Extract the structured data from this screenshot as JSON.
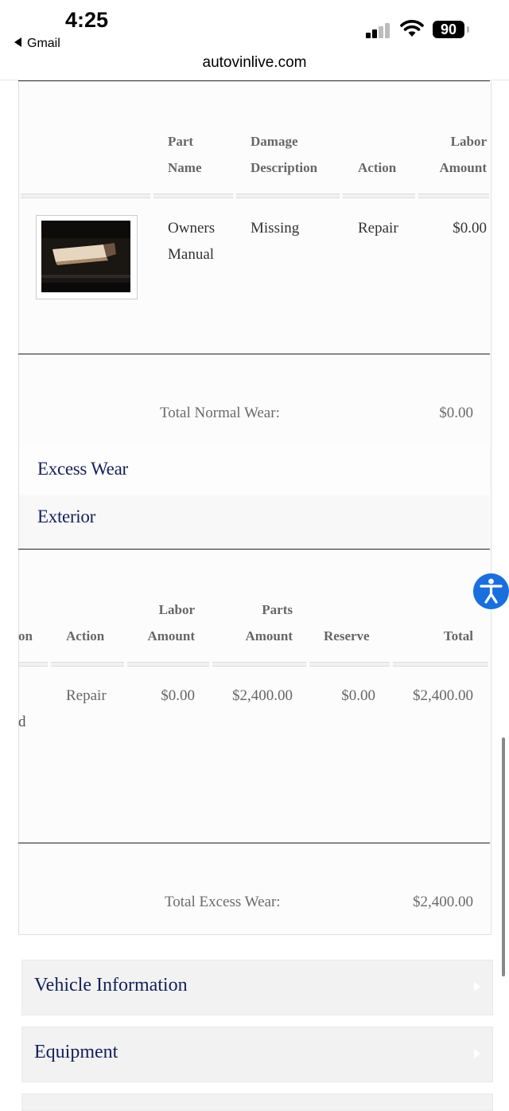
{
  "status_bar": {
    "time": "4:25",
    "back_app": "Gmail",
    "url": "autovinlive.com",
    "battery": "90"
  },
  "normal_wear": {
    "headers": {
      "part_name_1": "Part",
      "part_name_2": "Name",
      "damage_1": "Damage",
      "damage_2": "Description",
      "action": "Action",
      "labor_1": "Labor",
      "labor_2": "Amount"
    },
    "row": {
      "part_name_1": "Owners",
      "part_name_2": "Manual",
      "damage": "Missing",
      "action": "Repair",
      "labor": "$0.00",
      "image_icon": "owners-manual-photo"
    },
    "total_label": "Total Normal Wear:",
    "total_value": "$0.00"
  },
  "excess_wear": {
    "title": "Excess Wear",
    "subtitle": "Exterior",
    "headers": {
      "cut_off": "on",
      "action": "Action",
      "labor_1": "Labor",
      "labor_2": "Amount",
      "parts_1": "Parts",
      "parts_2": "Amount",
      "reserve": "Reserve",
      "total": "Total"
    },
    "row": {
      "cut_off": "d",
      "action": "Repair",
      "labor": "$0.00",
      "parts": "$2,400.00",
      "reserve": "$0.00",
      "total": "$2,400.00"
    },
    "total_label": "Total Excess Wear:",
    "total_value": "$2,400.00"
  },
  "accordions": [
    {
      "label": "Vehicle Information"
    },
    {
      "label": "Equipment"
    }
  ],
  "colors": {
    "heading_navy": "#14205a",
    "accessibility_blue": "#1a6fdc"
  }
}
